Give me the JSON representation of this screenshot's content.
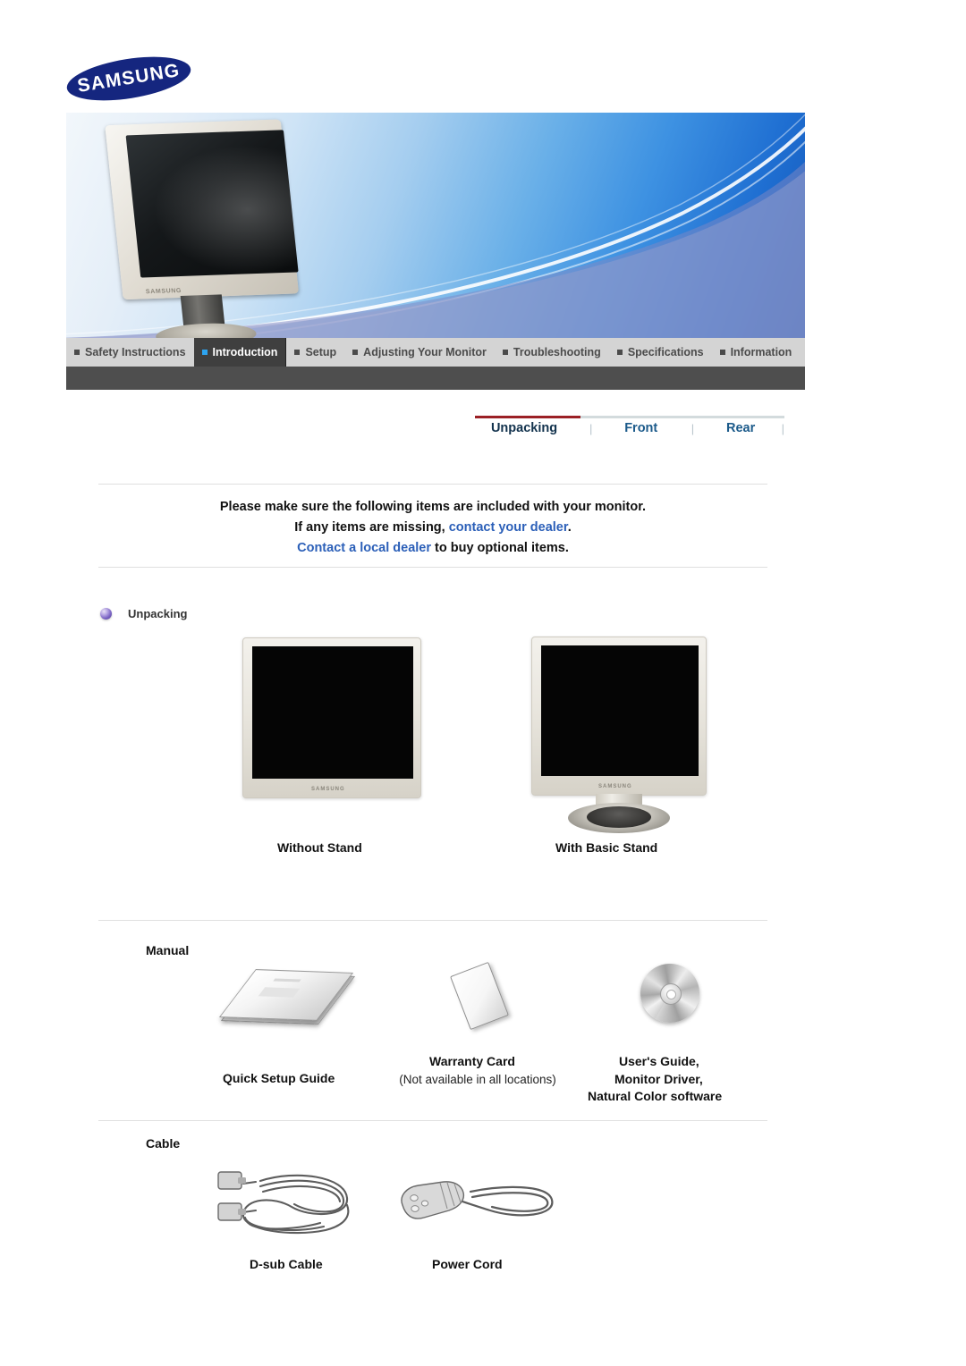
{
  "brand": {
    "logo_text": "SAMSUNG"
  },
  "nav": {
    "items": [
      {
        "label": "Safety Instructions",
        "active": false
      },
      {
        "label": "Introduction",
        "active": true
      },
      {
        "label": "Setup",
        "active": false
      },
      {
        "label": "Adjusting Your Monitor",
        "active": false
      },
      {
        "label": "Troubleshooting",
        "active": false
      },
      {
        "label": "Specifications",
        "active": false
      },
      {
        "label": "Information",
        "active": false
      }
    ]
  },
  "subnav": {
    "items": [
      {
        "label": "Unpacking",
        "active": true
      },
      {
        "label": "Front",
        "active": false
      },
      {
        "label": "Rear",
        "active": false
      }
    ],
    "separator": "|"
  },
  "intro": {
    "line1": "Please make sure the following items are included with your monitor.",
    "line2_prefix": "If any items are missing, ",
    "line2_link": "contact your dealer",
    "line2_suffix": ".",
    "line3_link": "Contact a local dealer",
    "line3_suffix": " to buy optional items."
  },
  "sections": {
    "unpacking": {
      "heading": "Unpacking",
      "items": [
        {
          "label": "Without Stand",
          "icon": "monitor-without-stand"
        },
        {
          "label": "With Basic Stand",
          "icon": "monitor-with-stand"
        }
      ]
    },
    "manual": {
      "heading": "Manual",
      "items": [
        {
          "label": "Quick Setup Guide",
          "sub": "",
          "icon": "booklet-icon"
        },
        {
          "label": "Warranty Card",
          "sub": "(Not available in all locations)",
          "icon": "card-icon"
        },
        {
          "label": "User's Guide,\nMonitor Driver,\nNatural Color software",
          "label_line1": "User's Guide,",
          "label_line2": "Monitor Driver,",
          "label_line3": "Natural Color software",
          "icon": "cd-disc-icon"
        }
      ]
    },
    "cable": {
      "heading": "Cable",
      "items": [
        {
          "label": "D-sub Cable",
          "icon": "dsub-cable-icon"
        },
        {
          "label": "Power Cord",
          "icon": "power-cord-icon"
        }
      ]
    }
  },
  "monitor_brand_text": "SAMSUNG",
  "colors": {
    "nav_bg": "#d4d4d4",
    "nav_active_bg": "#3f3f3f",
    "nav_active_bullet": "#2da4f0",
    "nav_underbar": "#4e4e4e",
    "subnav_active_rule": "#9b2025",
    "subnav_rule": "#d3dbdd",
    "link": "#2b5fb8",
    "subnav_link": "#1b5a8a",
    "logo_navy": "#15267f"
  }
}
